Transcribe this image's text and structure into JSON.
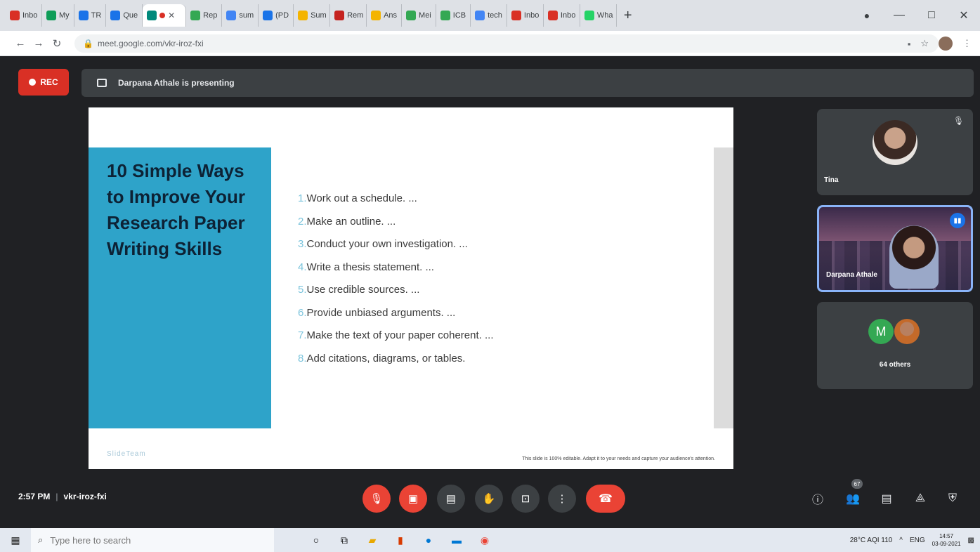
{
  "browser": {
    "tabs": [
      {
        "label": "Inbo",
        "icon": "gmail-icon",
        "color": "#d93025"
      },
      {
        "label": "My",
        "icon": "drive-icon",
        "color": "#0f9d58"
      },
      {
        "label": "TR",
        "icon": "forms-icon",
        "color": "#1a73e8"
      },
      {
        "label": "Que",
        "icon": "forms-icon",
        "color": "#1a73e8"
      },
      {
        "label": "",
        "icon": "meet-icon",
        "color": "#00897b",
        "active": true
      },
      {
        "label": "Rep",
        "icon": "web-icon",
        "color": "#34a853"
      },
      {
        "label": "sum",
        "icon": "google-icon",
        "color": "#4285f4"
      },
      {
        "label": "(PD",
        "icon": "docs-icon",
        "color": "#1a73e8"
      },
      {
        "label": "Sum",
        "icon": "slides-icon",
        "color": "#f4b400"
      },
      {
        "label": "Rem",
        "icon": "bookmark-icon",
        "color": "#c5221f"
      },
      {
        "label": "Ans",
        "icon": "note-icon",
        "color": "#f4b400"
      },
      {
        "label": "Mei",
        "icon": "web-icon",
        "color": "#34a853"
      },
      {
        "label": "ICB",
        "icon": "web-icon",
        "color": "#34a853"
      },
      {
        "label": "tech",
        "icon": "google-icon",
        "color": "#4285f4"
      },
      {
        "label": "Inbo",
        "icon": "gmail-icon",
        "color": "#d93025"
      },
      {
        "label": "Inbo",
        "icon": "gmail-icon",
        "color": "#d93025"
      },
      {
        "label": "Wha",
        "icon": "whatsapp-icon",
        "color": "#25d366"
      }
    ],
    "url": "meet.google.com/vkr-iroz-fxi"
  },
  "meet": {
    "rec_label": "REC",
    "presenting_text": "Darpana Athale is presenting",
    "time": "2:57 PM",
    "meeting_code": "vkr-iroz-fxi",
    "people_count": "67"
  },
  "slide": {
    "title": "10 Simple Ways to Improve Your Research Paper Writing Skills",
    "items": [
      {
        "num": "1.",
        "text": "Work out a schedule. ..."
      },
      {
        "num": "2.",
        "text": "Make an outline. ..."
      },
      {
        "num": "3.",
        "text": "Conduct your own investigation. ..."
      },
      {
        "num": "4.",
        "text": "Write a thesis statement. ..."
      },
      {
        "num": "5.",
        "text": "Use credible sources. ..."
      },
      {
        "num": "6.",
        "text": "Provide unbiased arguments. ..."
      },
      {
        "num": "7.",
        "text": "Make the text of your paper coherent. ..."
      },
      {
        "num": "8.",
        "text": "Add citations, diagrams, or tables."
      }
    ],
    "logo": "SlideTeam",
    "footer": "This slide is 100% editable. Adapt it to your needs and capture your audience's attention."
  },
  "participants": {
    "tile1_name": "Tina",
    "tile2_name": "Darpana Athale",
    "avatar_letter": "M",
    "others": "64 others"
  },
  "taskbar": {
    "search_placeholder": "Type here to search",
    "weather": "28°C AQI 110",
    "lang": "ENG",
    "time": "14:57",
    "date": "03-09-2021"
  },
  "colors": {
    "slide_accent": "#2ea3c9",
    "rec_red": "#d93025",
    "meet_bg": "#202124"
  }
}
